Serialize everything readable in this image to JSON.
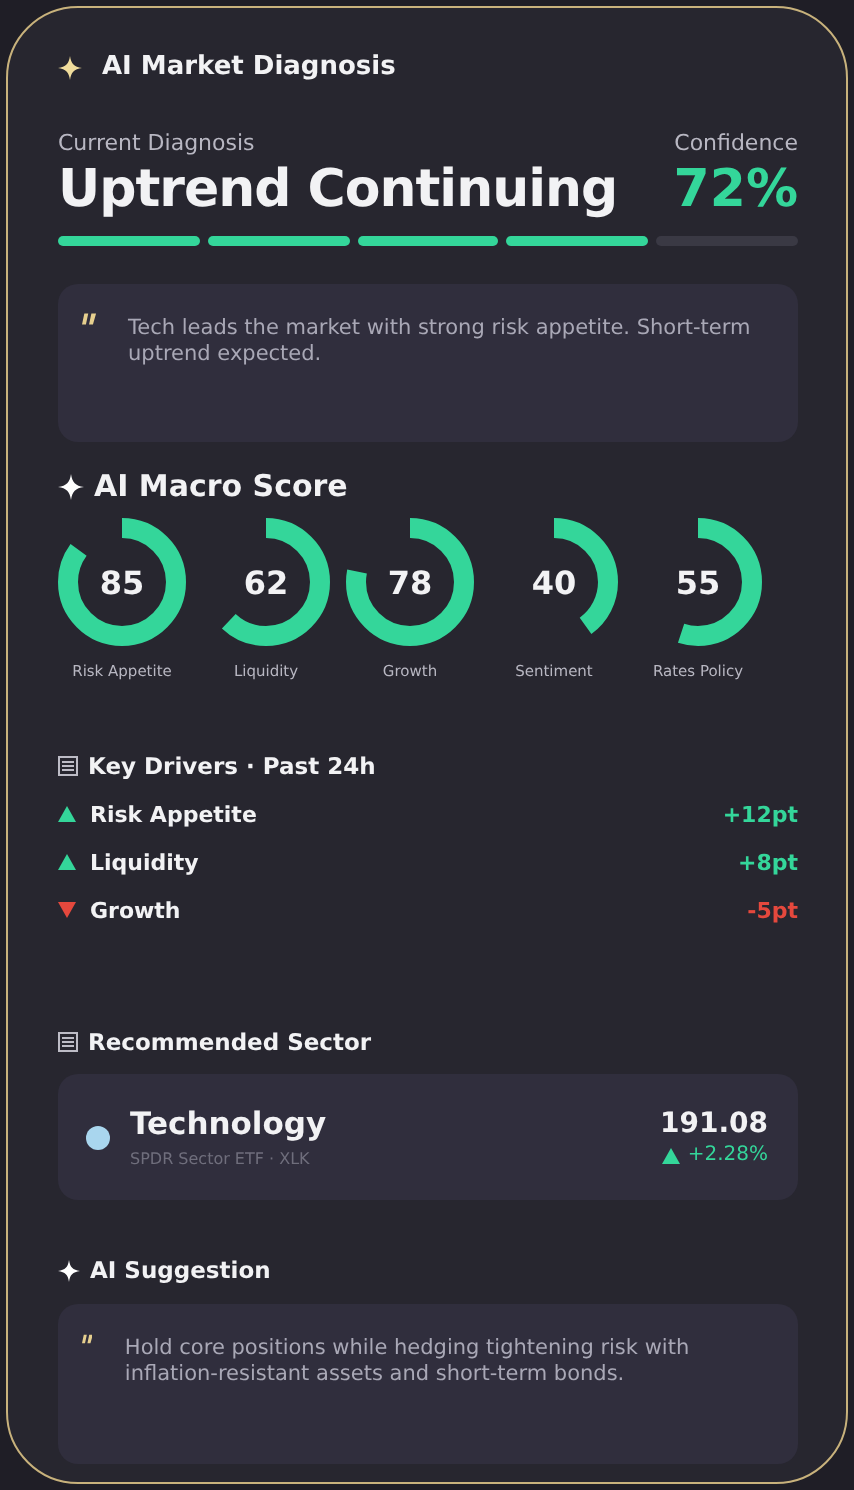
{
  "header": {
    "title": "AI Market Diagnosis"
  },
  "diagnosis": {
    "label": "Current Diagnosis",
    "value": "Uptrend Continuing",
    "confidence_label": "Confidence",
    "confidence": "72%",
    "level": 0.8
  },
  "summary": {
    "text": "Tech leads the market with strong risk appetite. Short-term uptrend expected."
  },
  "macro": {
    "title": "AI Macro Score",
    "scores": [
      {
        "value": "85",
        "label": "Risk Appetite",
        "level": 0.85
      },
      {
        "value": "62",
        "label": "Liquidity",
        "level": 0.62
      },
      {
        "value": "78",
        "label": "Growth",
        "level": 0.78
      },
      {
        "value": "40",
        "label": "Sentiment",
        "level": 0.4
      },
      {
        "value": "55",
        "label": "Rates Policy",
        "level": 0.55
      }
    ]
  },
  "drivers": {
    "title": "Key Drivers · Past 24h",
    "items": [
      {
        "kind": "up",
        "label": "Risk Appetite",
        "change": "+12pt"
      },
      {
        "kind": "up",
        "label": "Liquidity",
        "change": "+8pt"
      },
      {
        "kind": "down",
        "label": "Growth",
        "change": "-5pt"
      }
    ]
  },
  "sector": {
    "title": "Recommended Sector",
    "name": "Technology",
    "subtitle": "SPDR Sector ETF · XLK",
    "price": "191.08",
    "change": "+2.28%"
  },
  "suggestion": {
    "title": "AI Suggestion",
    "text": "Hold core positions while hedging tightening risk with inflation-resistant assets and short-term bonds."
  }
}
